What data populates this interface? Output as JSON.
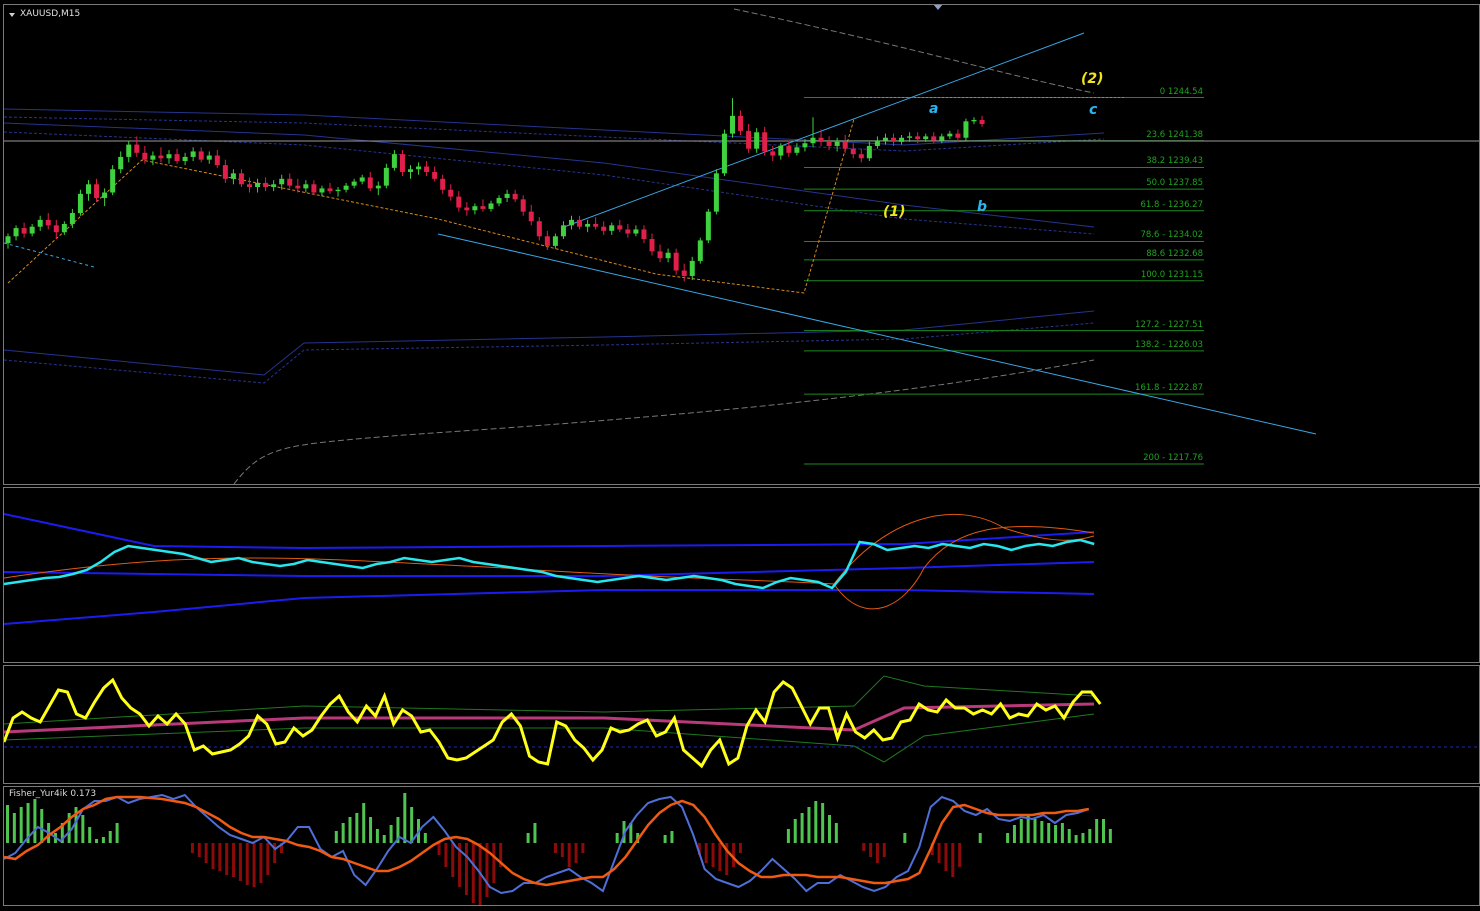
{
  "window": {
    "symbol_title": "XAUUSD,M15",
    "indicator_title": "Fisher_Yur4ik 0.173"
  },
  "colors": {
    "bull_candle": "#3fd13f",
    "bear_candle": "#e0204a",
    "fib_line": "#1d8a1d",
    "trend_line": "#3aa7e6",
    "wave_yellow": "#f2e31a",
    "wave_blue": "#2ab5ef",
    "envelope": "#2a3a9e",
    "osc_cyan": "#27e6ee",
    "osc_yellow": "#ffff19",
    "fisher_pos": "#4fc44f",
    "fisher_neg": "#8b0a0a",
    "fisher_blue": "#4f6fd8",
    "fisher_orange": "#f05a12"
  },
  "waves": {
    "w1": "(1)",
    "w2": "(2)",
    "a": "a",
    "b": "b",
    "c": "c"
  },
  "chart_data": {
    "type": "candlestick",
    "symbol": "XAUUSD",
    "timeframe": "M15",
    "fibonacci": [
      {
        "level": "0",
        "price": 1244.54,
        "text": "0 1244.54"
      },
      {
        "level": "23.6",
        "price": 1241.38,
        "text": "23.6 1241.38"
      },
      {
        "level": "38.2",
        "price": 1239.43,
        "text": "38.2 1239.43"
      },
      {
        "level": "50.0",
        "price": 1237.85,
        "text": "50.0 1237.85"
      },
      {
        "level": "61.8",
        "price": 1236.27,
        "text": "61.8 - 1236.27"
      },
      {
        "level": "78.6",
        "price": 1234.02,
        "text": "78.6 - 1234.02"
      },
      {
        "level": "88.6",
        "price": 1232.68,
        "text": "88.6 1232.68"
      },
      {
        "level": "100.0",
        "price": 1231.15,
        "text": "100.0 1231.15"
      },
      {
        "level": "127.2",
        "price": 1227.51,
        "text": "127.2 - 1227.51"
      },
      {
        "level": "138.2",
        "price": 1226.03,
        "text": "138.2 - 1226.03"
      },
      {
        "level": "161.8",
        "price": 1222.87,
        "text": "161.8 - 1222.87"
      },
      {
        "level": "200",
        "price": 1217.76,
        "text": "200 - 1217.76"
      }
    ],
    "ohlc": [
      [
        1233.9,
        1234.6,
        1233.5,
        1234.4
      ],
      [
        1234.4,
        1235.2,
        1234.1,
        1235.0
      ],
      [
        1235.0,
        1235.4,
        1234.3,
        1234.6
      ],
      [
        1234.6,
        1235.3,
        1234.4,
        1235.1
      ],
      [
        1235.1,
        1235.9,
        1234.8,
        1235.6
      ],
      [
        1235.6,
        1236.1,
        1234.9,
        1235.2
      ],
      [
        1235.2,
        1235.6,
        1234.2,
        1234.7
      ],
      [
        1234.7,
        1235.5,
        1234.5,
        1235.3
      ],
      [
        1235.3,
        1236.4,
        1235.0,
        1236.1
      ],
      [
        1236.1,
        1237.8,
        1235.9,
        1237.5
      ],
      [
        1237.5,
        1238.5,
        1237.0,
        1238.2
      ],
      [
        1238.2,
        1238.6,
        1236.9,
        1237.2
      ],
      [
        1237.2,
        1237.9,
        1236.6,
        1237.6
      ],
      [
        1237.6,
        1239.6,
        1237.4,
        1239.3
      ],
      [
        1239.3,
        1240.6,
        1239.0,
        1240.2
      ],
      [
        1240.2,
        1241.4,
        1239.8,
        1241.1
      ],
      [
        1241.1,
        1241.7,
        1240.2,
        1240.5
      ],
      [
        1240.5,
        1241.0,
        1239.7,
        1240.0
      ],
      [
        1240.0,
        1240.6,
        1239.6,
        1240.3
      ],
      [
        1240.3,
        1240.9,
        1239.8,
        1240.1
      ],
      [
        1240.1,
        1240.7,
        1239.7,
        1240.4
      ],
      [
        1240.4,
        1240.8,
        1239.7,
        1239.9
      ],
      [
        1239.9,
        1240.5,
        1239.6,
        1240.2
      ],
      [
        1240.2,
        1240.9,
        1239.9,
        1240.6
      ],
      [
        1240.6,
        1240.9,
        1239.8,
        1240.0
      ],
      [
        1240.0,
        1240.6,
        1239.7,
        1240.3
      ],
      [
        1240.3,
        1240.7,
        1239.4,
        1239.6
      ],
      [
        1239.6,
        1240.0,
        1238.3,
        1238.6
      ],
      [
        1238.6,
        1239.3,
        1238.2,
        1239.0
      ],
      [
        1239.0,
        1239.3,
        1238.0,
        1238.2
      ],
      [
        1238.2,
        1238.7,
        1237.6,
        1238.0
      ],
      [
        1238.0,
        1238.6,
        1237.6,
        1238.3
      ],
      [
        1238.3,
        1238.7,
        1237.7,
        1238.0
      ],
      [
        1238.0,
        1238.5,
        1237.7,
        1238.2
      ],
      [
        1238.2,
        1238.9,
        1237.8,
        1238.6
      ],
      [
        1238.6,
        1239.0,
        1237.9,
        1238.1
      ],
      [
        1238.1,
        1238.6,
        1237.6,
        1237.9
      ],
      [
        1237.9,
        1238.5,
        1237.6,
        1238.2
      ],
      [
        1238.2,
        1238.5,
        1237.4,
        1237.6
      ],
      [
        1237.6,
        1238.1,
        1237.3,
        1237.9
      ],
      [
        1237.9,
        1238.3,
        1237.5,
        1237.7
      ],
      [
        1237.7,
        1238.0,
        1237.3,
        1237.8
      ],
      [
        1237.8,
        1238.3,
        1237.6,
        1238.1
      ],
      [
        1238.1,
        1238.6,
        1237.9,
        1238.4
      ],
      [
        1238.4,
        1238.9,
        1238.2,
        1238.7
      ],
      [
        1238.7,
        1239.1,
        1237.7,
        1237.9
      ],
      [
        1237.9,
        1238.4,
        1237.4,
        1238.1
      ],
      [
        1238.1,
        1239.7,
        1237.9,
        1239.4
      ],
      [
        1239.4,
        1240.7,
        1239.2,
        1240.4
      ],
      [
        1240.4,
        1240.7,
        1238.8,
        1239.1
      ],
      [
        1239.1,
        1239.6,
        1238.6,
        1239.3
      ],
      [
        1239.3,
        1239.8,
        1238.9,
        1239.5
      ],
      [
        1239.5,
        1239.9,
        1238.8,
        1239.1
      ],
      [
        1239.1,
        1239.5,
        1238.4,
        1238.6
      ],
      [
        1238.6,
        1238.9,
        1237.5,
        1237.8
      ],
      [
        1237.8,
        1238.2,
        1237.0,
        1237.3
      ],
      [
        1237.3,
        1237.7,
        1236.2,
        1236.5
      ],
      [
        1236.5,
        1236.9,
        1235.9,
        1236.3
      ],
      [
        1236.3,
        1236.8,
        1236.0,
        1236.6
      ],
      [
        1236.6,
        1237.1,
        1236.2,
        1236.4
      ],
      [
        1236.4,
        1237.0,
        1236.2,
        1236.8
      ],
      [
        1236.8,
        1237.4,
        1236.6,
        1237.2
      ],
      [
        1237.2,
        1237.8,
        1236.9,
        1237.5
      ],
      [
        1237.5,
        1237.8,
        1236.9,
        1237.1
      ],
      [
        1237.1,
        1237.4,
        1235.9,
        1236.2
      ],
      [
        1236.2,
        1236.7,
        1235.2,
        1235.5
      ],
      [
        1235.5,
        1235.8,
        1234.1,
        1234.4
      ],
      [
        1234.4,
        1234.8,
        1233.4,
        1233.7
      ],
      [
        1233.7,
        1234.6,
        1233.5,
        1234.4
      ],
      [
        1234.4,
        1235.5,
        1234.2,
        1235.2
      ],
      [
        1235.2,
        1235.9,
        1234.9,
        1235.6
      ],
      [
        1235.6,
        1235.9,
        1234.9,
        1235.1
      ],
      [
        1235.1,
        1235.6,
        1234.7,
        1235.3
      ],
      [
        1235.3,
        1235.8,
        1234.9,
        1235.1
      ],
      [
        1235.1,
        1235.5,
        1234.5,
        1234.8
      ],
      [
        1234.8,
        1235.4,
        1234.5,
        1235.2
      ],
      [
        1235.2,
        1235.6,
        1234.7,
        1234.9
      ],
      [
        1234.9,
        1235.3,
        1234.3,
        1234.6
      ],
      [
        1234.6,
        1235.2,
        1234.4,
        1234.9
      ],
      [
        1234.9,
        1235.2,
        1233.9,
        1234.2
      ],
      [
        1234.2,
        1234.6,
        1233.0,
        1233.3
      ],
      [
        1233.3,
        1233.8,
        1232.5,
        1232.8
      ],
      [
        1232.8,
        1233.5,
        1232.5,
        1233.2
      ],
      [
        1233.2,
        1233.5,
        1231.6,
        1231.9
      ],
      [
        1231.9,
        1232.4,
        1231.1,
        1231.5
      ],
      [
        1231.5,
        1232.9,
        1231.2,
        1232.6
      ],
      [
        1232.6,
        1234.3,
        1232.4,
        1234.1
      ],
      [
        1234.1,
        1236.4,
        1233.9,
        1236.2
      ],
      [
        1236.2,
        1239.3,
        1236.0,
        1239.0
      ],
      [
        1239.0,
        1242.2,
        1238.8,
        1241.9
      ],
      [
        1241.9,
        1244.5,
        1241.6,
        1243.2
      ],
      [
        1243.2,
        1243.6,
        1241.8,
        1242.1
      ],
      [
        1242.1,
        1242.6,
        1240.5,
        1240.8
      ],
      [
        1240.8,
        1242.3,
        1240.5,
        1242.0
      ],
      [
        1242.0,
        1242.4,
        1240.3,
        1240.6
      ],
      [
        1240.6,
        1241.0,
        1239.9,
        1240.3
      ],
      [
        1240.3,
        1241.2,
        1240.0,
        1241.0
      ],
      [
        1241.0,
        1241.4,
        1240.2,
        1240.5
      ],
      [
        1240.5,
        1241.2,
        1240.3,
        1240.9
      ],
      [
        1240.9,
        1241.5,
        1240.6,
        1241.2
      ],
      [
        1241.2,
        1243.1,
        1240.9,
        1241.6
      ],
      [
        1241.6,
        1242.2,
        1241.0,
        1241.3
      ],
      [
        1241.3,
        1241.7,
        1240.7,
        1241.0
      ],
      [
        1241.0,
        1241.6,
        1240.6,
        1241.3
      ],
      [
        1241.3,
        1241.8,
        1240.5,
        1240.8
      ],
      [
        1240.8,
        1241.2,
        1240.1,
        1240.4
      ],
      [
        1240.4,
        1240.8,
        1239.8,
        1240.1
      ],
      [
        1240.1,
        1241.3,
        1239.9,
        1241.0
      ],
      [
        1241.0,
        1241.7,
        1240.8,
        1241.4
      ],
      [
        1241.4,
        1241.9,
        1241.1,
        1241.6
      ],
      [
        1241.6,
        1241.9,
        1241.0,
        1241.3
      ],
      [
        1241.3,
        1241.8,
        1241.1,
        1241.6
      ],
      [
        1241.6,
        1242.0,
        1241.3,
        1241.7
      ],
      [
        1241.7,
        1242.0,
        1241.2,
        1241.5
      ],
      [
        1241.5,
        1241.9,
        1241.3,
        1241.7
      ],
      [
        1241.7,
        1242.0,
        1241.2,
        1241.4
      ],
      [
        1241.4,
        1241.9,
        1241.2,
        1241.7
      ],
      [
        1241.7,
        1242.1,
        1241.5,
        1241.9
      ],
      [
        1241.9,
        1242.2,
        1241.3,
        1241.6
      ],
      [
        1241.6,
        1243.0,
        1241.4,
        1242.8
      ],
      [
        1242.8,
        1243.1,
        1242.6,
        1242.9
      ],
      [
        1242.9,
        1243.2,
        1242.4,
        1242.6
      ]
    ]
  }
}
